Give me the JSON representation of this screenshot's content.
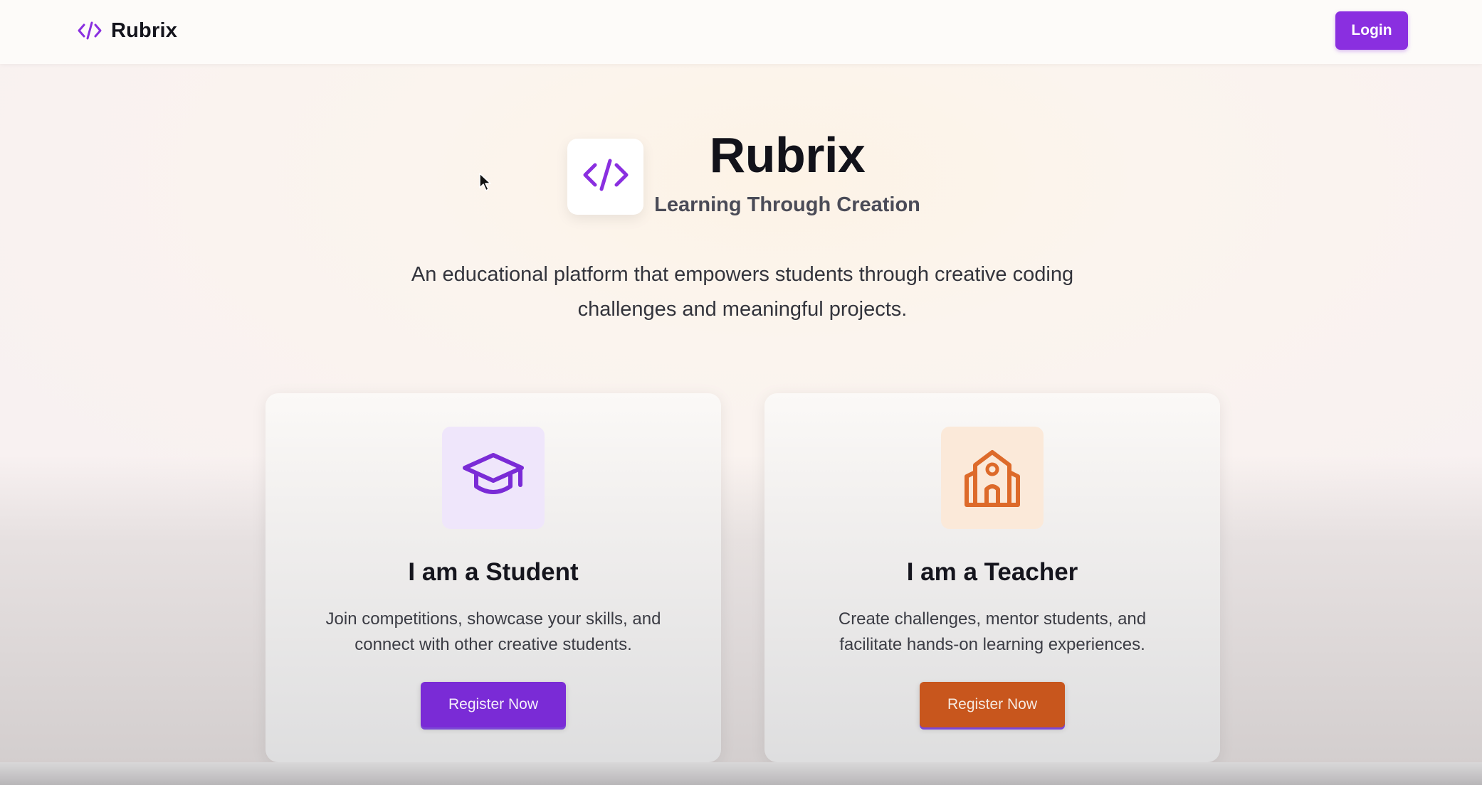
{
  "header": {
    "brand_name": "Rubrix",
    "brand_icon": "code-icon",
    "login_label": "Login"
  },
  "hero": {
    "logo_icon": "code-icon",
    "title": "Rubrix",
    "subtitle": "Learning Through Creation",
    "description": "An educational platform that empowers students through creative coding challenges and meaningful projects."
  },
  "cards": [
    {
      "icon": "graduation-cap-icon",
      "title": "I am a Student",
      "description": "Join competitions, showcase your skills, and connect with other creative students.",
      "button_label": "Register Now"
    },
    {
      "icon": "school-building-icon",
      "title": "I am a Teacher",
      "description": "Create challenges, mentor students, and facilitate hands-on learning experiences.",
      "button_label": "Register Now"
    }
  ],
  "colors": {
    "brand_purple": "#8a2fe0",
    "student_button": "#7a2bd6",
    "teacher_button": "#c8561d",
    "teacher_icon": "#dd6a2a"
  }
}
